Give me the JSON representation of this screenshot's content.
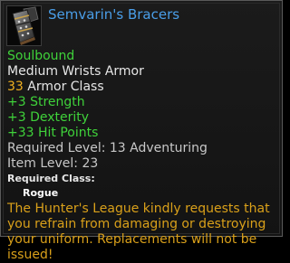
{
  "item": {
    "name": "Semvarin's Bracers",
    "icon": "bracers-icon",
    "binding": "Soulbound",
    "slot_type": "Medium Wrists Armor",
    "armor_class_value": "33",
    "armor_class_label": "Armor Class",
    "stats": [
      "+3 Strength",
      "+3 Dexterity",
      "+33 Hit Points"
    ],
    "required_level": "Required Level: 13 Adventuring",
    "item_level": "Item Level: 23",
    "required_class_label": "Required Class:",
    "required_class": "Rogue",
    "flavor_text": "The Hunter's League kindly requests that you refrain from damaging or destroying your uniform. Replacements will not be issued!"
  },
  "colors": {
    "title": "#4a9ee8",
    "binding": "#3fd23a",
    "armor_value": "#f0b020",
    "stat": "#3fd23a",
    "normal": "#e6e6e6",
    "muted": "#c8c8c8",
    "flavor": "#d9a01a"
  }
}
